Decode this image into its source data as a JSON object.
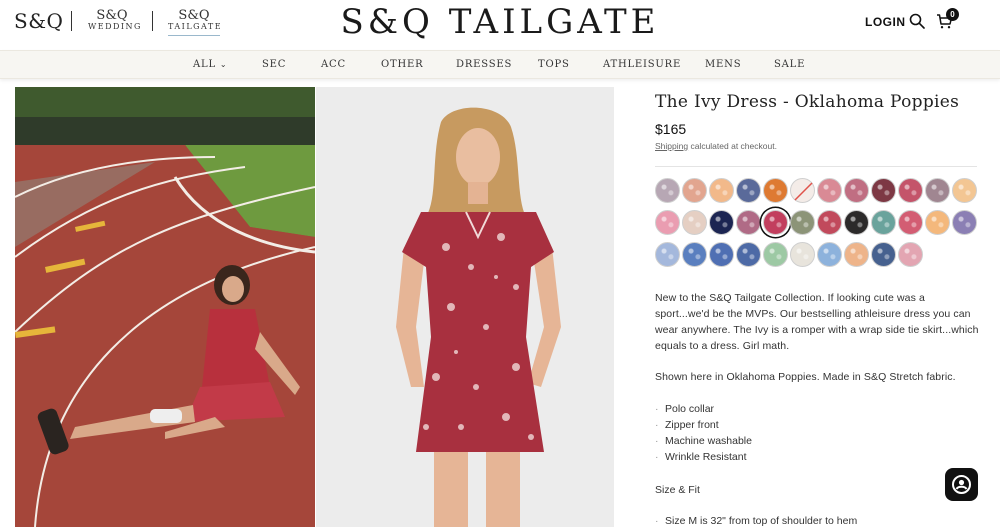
{
  "header": {
    "brand_main": "S&Q",
    "brand_wedding_top": "S&Q",
    "brand_wedding_bottom": "WEDDING",
    "brand_tailgate_top": "S&Q",
    "brand_tailgate_bottom": "TAILGATE",
    "logo": "S&Q TAILGATE",
    "login": "LOGIN",
    "cart_count": "0"
  },
  "nav": {
    "items": [
      "ALL",
      "SEC",
      "ACC",
      "OTHER",
      "DRESSES",
      "TOPS",
      "ATHLEISURE",
      "MENS",
      "SALE"
    ]
  },
  "product": {
    "title": "The Ivy Dress - Oklahoma Poppies",
    "price": "$165",
    "shipping_link": "Shipping",
    "shipping_text": " calculated at checkout.",
    "description_1": "New to the S&Q Tailgate Collection. If looking cute was a sport...we'd be the MVPs. Our bestselling athleisure dress you can wear anywhere. The Ivy is a romper with a wrap side tie skirt...which equals to a dress. Girl math.",
    "description_2": "Shown here in Oklahoma Poppies. Made in S&Q Stretch fabric.",
    "bullets": [
      "Polo collar",
      "Zipper front",
      "Machine washable",
      "Wrinkle Resistant"
    ],
    "size_fit_heading": "Size & Fit",
    "size_bullets": [
      "Size M is 32\" from top of shoulder to hem"
    ]
  },
  "colors": {
    "swatches": [
      "#b7a7b4",
      "#e2a58f",
      "#f2b98a",
      "#5a6a9a",
      "#de7a32",
      "#f4ece8",
      "#d98a95",
      "#c06e82",
      "#7d3844",
      "#c4546a",
      "#a08691",
      "#f3c693",
      "#ea9db1",
      "#e5cfc3",
      "#1c2552",
      "#b06b86",
      "#c23f5e",
      "#8c9478",
      "#c14a5c",
      "#2c2a2a",
      "#6aa39c",
      "#d35d73",
      "#f4b87c",
      "#8b7fb4",
      "#a4b8dc",
      "#5a7fbf",
      "#4f6fb3",
      "#4d6aa6",
      "#9dc9a4",
      "#e8e4dc",
      "#8db2dc",
      "#eeb48a",
      "#46618f",
      "#e3a5b2"
    ],
    "selected_index": 16
  }
}
